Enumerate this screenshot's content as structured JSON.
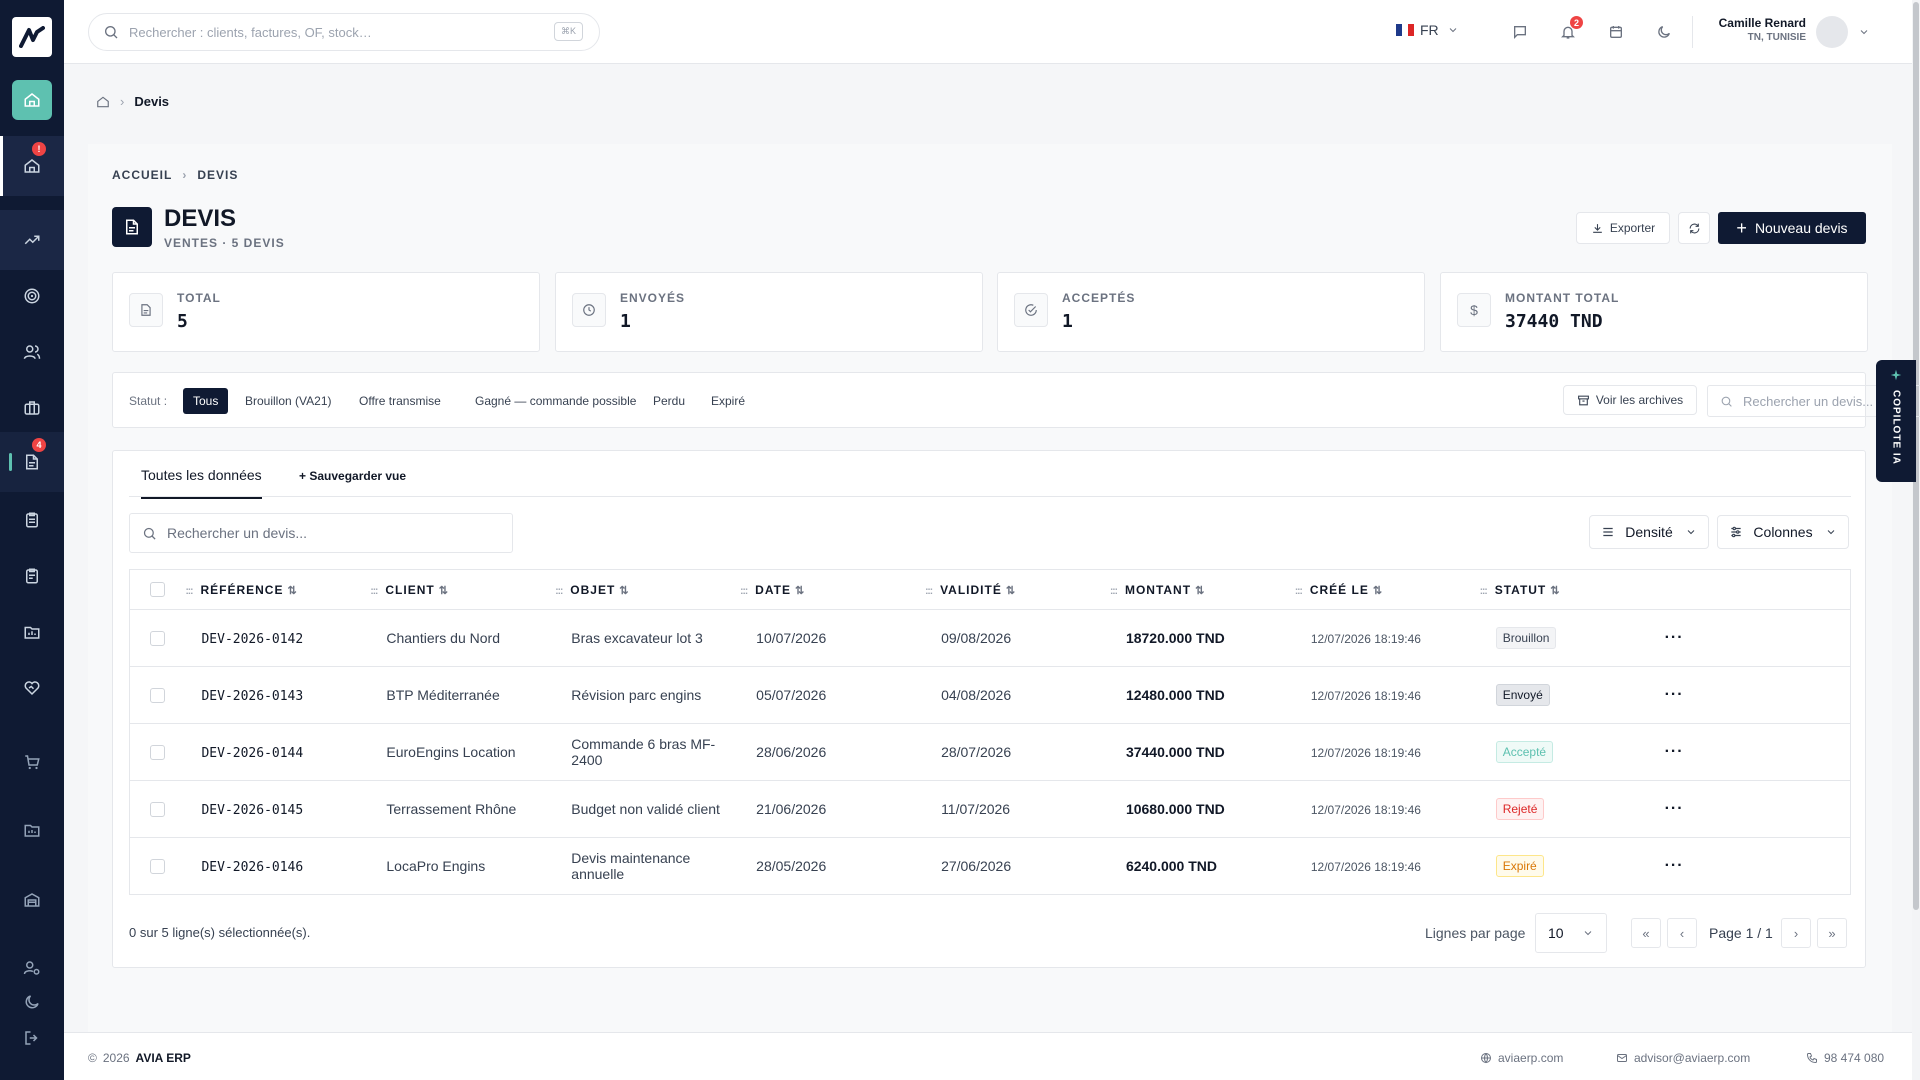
{
  "topbar": {
    "search_placeholder": "Rechercher : clients, factures, OF, stock…",
    "search_shortcut": "⌘K",
    "lang": "FR",
    "notif_count": "2",
    "user_name": "Camille Renard",
    "user_region": "TN, TUNISIE"
  },
  "sidebar": {
    "badge_home": "!",
    "badge_devis": "4"
  },
  "breadcrumb_top": {
    "current": "Devis"
  },
  "breadcrumb": {
    "home": "ACCUEIL",
    "current": "DEVIS"
  },
  "page": {
    "title": "DEVIS",
    "subtitle": "VENTES · 5 DEVIS",
    "export_label": "Exporter",
    "new_label": "Nouveau devis"
  },
  "stats": [
    {
      "label": "TOTAL",
      "value": "5"
    },
    {
      "label": "ENVOYÉS",
      "value": "1"
    },
    {
      "label": "ACCEPTÉS",
      "value": "1"
    },
    {
      "label": "MONTANT TOTAL",
      "value": "37440 TND"
    }
  ],
  "filters": {
    "status_label": "Statut :",
    "chips": [
      "Tous",
      "Brouillon (VA21)",
      "Offre transmise",
      "Gagné — commande possible",
      "Perdu",
      "Expiré"
    ],
    "archive_label": "Voir les archives",
    "search_placeholder": "Rechercher un devis..."
  },
  "copilot": {
    "label": "COPILOTE IA"
  },
  "table": {
    "tab_all": "Toutes les données",
    "save_view": "+ Sauvegarder vue",
    "search_placeholder": "Rechercher un devis...",
    "density_label": "Densité",
    "columns_label": "Colonnes",
    "headers": [
      "RÉFÉRENCE",
      "CLIENT",
      "OBJET",
      "DATE",
      "VALIDITÉ",
      "MONTANT",
      "CRÉÉ LE",
      "STATUT"
    ],
    "rows": [
      {
        "ref": "DEV-2026-0142",
        "client": "Chantiers du Nord",
        "objet": "Bras excavateur lot 3",
        "date": "10/07/2026",
        "validite": "09/08/2026",
        "montant": "18720.000 TND",
        "cree": "12/07/2026 18:19:46",
        "statut": "Brouillon",
        "color": "#374151",
        "bg": "#f3f4f6",
        "border": "#e5e7eb"
      },
      {
        "ref": "DEV-2026-0143",
        "client": "BTP Méditerranée",
        "objet": "Révision parc engins",
        "date": "05/07/2026",
        "validite": "04/08/2026",
        "montant": "12480.000 TND",
        "cree": "12/07/2026 18:19:46",
        "statut": "Envoyé",
        "color": "#111827",
        "bg": "#e5e7eb",
        "border": "#d1d5db"
      },
      {
        "ref": "DEV-2026-0144",
        "client": "EuroEngins Location",
        "objet": "Commande 6 bras MF-2400",
        "date": "28/06/2026",
        "validite": "28/07/2026",
        "montant": "37440.000 TND",
        "cree": "12/07/2026 18:19:46",
        "statut": "Accepté",
        "color": "#5ec1b0",
        "bg": "#effaf7",
        "border": "#c5ebe3"
      },
      {
        "ref": "DEV-2026-0145",
        "client": "Terrassement Rhône",
        "objet": "Budget non validé client",
        "date": "21/06/2026",
        "validite": "11/07/2026",
        "montant": "10680.000 TND",
        "cree": "12/07/2026 18:19:46",
        "statut": "Rejeté",
        "color": "#dc2626",
        "bg": "#fef2f2",
        "border": "#fecaca"
      },
      {
        "ref": "DEV-2026-0146",
        "client": "LocaPro Engins",
        "objet": "Devis maintenance annuelle",
        "date": "28/05/2026",
        "validite": "27/06/2026",
        "montant": "6240.000 TND",
        "cree": "12/07/2026 18:19:46",
        "statut": "Expiré",
        "color": "#d97706",
        "bg": "#fffbeb",
        "border": "#fde68a"
      }
    ],
    "selection_text": "0 sur 5 ligne(s) sélectionnée(s).",
    "rows_per_page_label": "Lignes par page",
    "rows_per_page": "10",
    "page_text": "Page 1 / 1"
  },
  "footer": {
    "copyright": "2026",
    "brand": "AVIA ERP",
    "website": "aviaerp.com",
    "email": "advisor@aviaerp.com",
    "phone": "98 474 080"
  }
}
